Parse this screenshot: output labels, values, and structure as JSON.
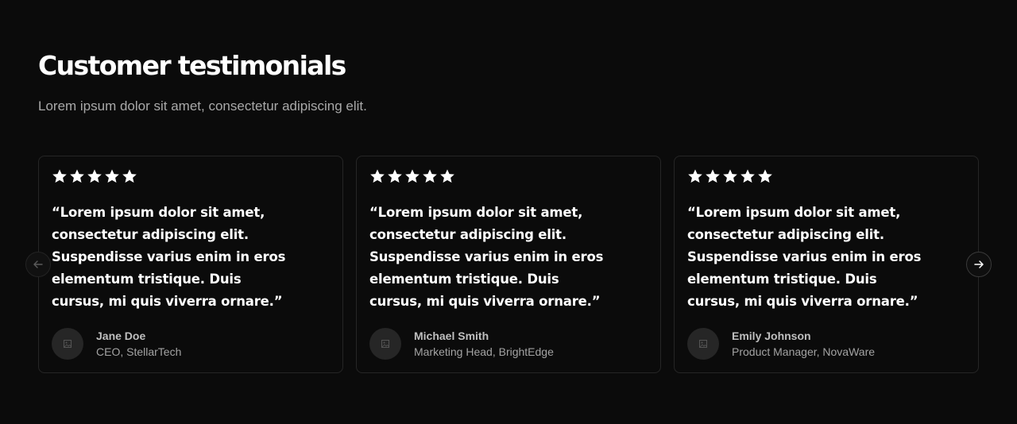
{
  "section": {
    "title": "Customer testimonials",
    "subtitle": "Lorem ipsum dolor sit amet, consectetur adipiscing elit."
  },
  "testimonials": [
    {
      "rating": 5,
      "quote": "“Lorem ipsum dolor sit amet, consectetur adipiscing elit. Suspendisse varius enim in eros elementum tristique. Duis cursus, mi quis viverra ornare.”",
      "name": "Jane Doe",
      "role": "CEO, StellarTech"
    },
    {
      "rating": 5,
      "quote": "“Lorem ipsum dolor sit amet, consectetur adipiscing elit. Suspendisse varius enim in eros elementum tristique. Duis cursus, mi quis viverra ornare.”",
      "name": "Michael Smith",
      "role": "Marketing Head, BrightEdge"
    },
    {
      "rating": 5,
      "quote": "“Lorem ipsum dolor sit amet, consectetur adipiscing elit. Suspendisse varius enim in eros elementum tristique. Duis cursus, mi quis viverra ornare.”",
      "name": "Emily Johnson",
      "role": "Product Manager, NovaWare"
    }
  ],
  "navigation": {
    "prev_icon": "arrow-left-icon",
    "next_icon": "arrow-right-icon"
  },
  "colors": {
    "background": "#0b0b0b",
    "card_border": "#262626",
    "text_primary": "#ffffff",
    "text_muted": "#a9a9a9"
  }
}
